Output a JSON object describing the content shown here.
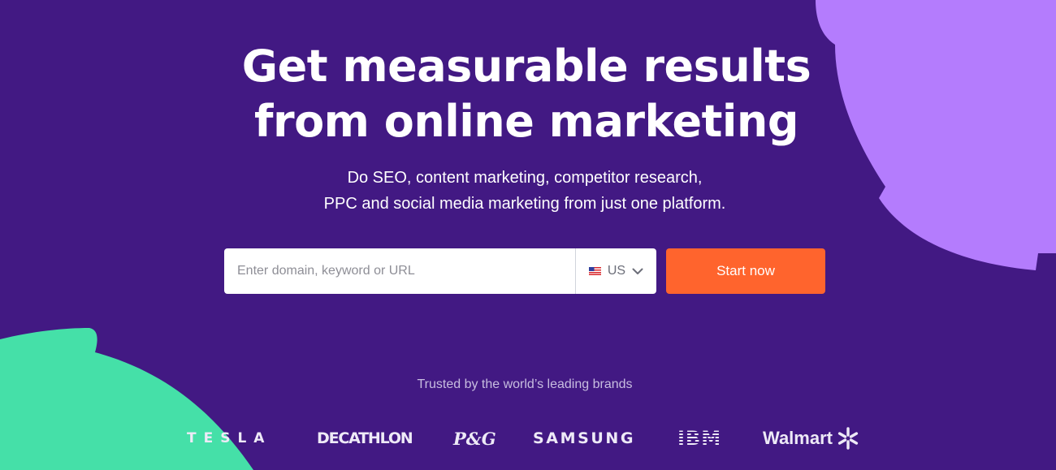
{
  "colors": {
    "background": "#421983",
    "accent_purple": "#B47CFD",
    "accent_green": "#45E0A8",
    "cta": "#FF642D"
  },
  "hero": {
    "headline_line1": "Get measurable results",
    "headline_line2": "from online marketing",
    "subtitle_line1": "Do SEO, content marketing, competitor research,",
    "subtitle_line2": "PPC and social media marketing from just one platform."
  },
  "search": {
    "placeholder": "Enter domain, keyword or URL",
    "value": "",
    "database_flag_icon": "us-flag-icon",
    "database_label": "US",
    "dropdown_icon": "chevron-down-icon",
    "button_label": "Start now"
  },
  "trusted": {
    "label": "Trusted by the world’s leading brands",
    "logos": [
      "TESLA",
      "DECATHLON",
      "P&G",
      "SAMSUNG",
      "IBM",
      "Walmart"
    ]
  }
}
